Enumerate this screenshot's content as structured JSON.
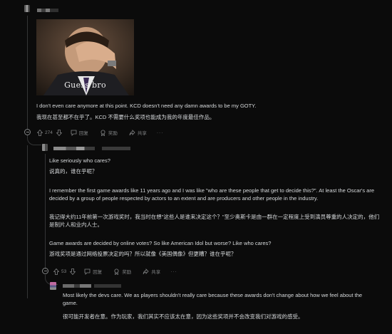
{
  "comment1": {
    "image_caption": "Guess bro",
    "text_en": "I don't even care anymore at this point. KCD doesn't need any damn awards to be my GOTY.",
    "text_zh": "我现在甚至都不在乎了。KCD 不需要什么奖项也能成为我的年度最佳作品。",
    "votes": "274",
    "reply_label": "回复",
    "award_label": "奖励",
    "share_label": "共享"
  },
  "comment2": {
    "lines": [
      "Like seriously who cares?",
      "说真的，谁在乎呢？",
      "I remember the first game awards like 11 years ago and I was like \"who are these people that get to decide this?\". At least the Oscar's are decided by a group of people respected by actors to an extent and are producers and other people in the industry.",
      "我记得大约11年前第一次游戏奖时，我当时在想\"这些人是谁来决定这个？\"至少奥斯卡是由一群在一定程度上受到演员尊重的人决定的，他们是制片人和业内人士。",
      "Game awards are decided by online votes? So like American Idol but worse? Like who cares?",
      "游戏奖项是通过网络投票决定的吗？所以就像《美国偶像》但更糟？谁在乎呢？"
    ],
    "votes": "53",
    "reply_label": "回复",
    "award_label": "奖励",
    "share_label": "共享"
  },
  "comment3": {
    "text_en": "Most likely the devs care. We as players shouldn't really care because these awards don't change about how we feel about the game.",
    "text_zh": "很可能开发者在意。作为玩家，我们其实不应该太在意，因为这些奖项并不会改变我们对游戏的感受。"
  }
}
